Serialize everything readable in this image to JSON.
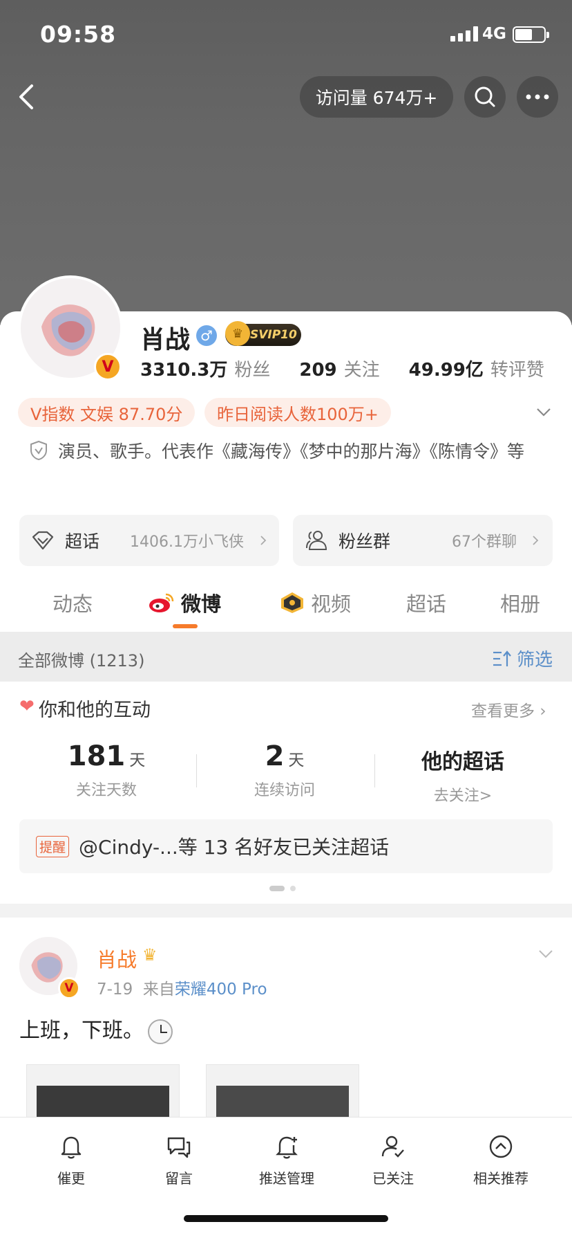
{
  "status": {
    "time": "09:58",
    "network": "4G"
  },
  "header": {
    "visits": "访问量 674万+"
  },
  "profile": {
    "name": "肖战",
    "svip": "SVIP10",
    "verify_mark": "♂",
    "v_badge": "V",
    "followers_num": "3310.3万",
    "followers_label": "粉丝",
    "following_num": "209",
    "following_label": "关注",
    "likes_num": "49.99亿",
    "likes_label": "转评赞",
    "tag1": "V指数 文娱 87.70分",
    "tag2": "昨日阅读人数100万+",
    "bio": "演员、歌手。代表作《藏海传》《梦中的那片海》《陈情令》等"
  },
  "pills": {
    "supertopic_label": "超话",
    "supertopic_value": "1406.1万小飞侠",
    "fangroup_label": "粉丝群",
    "fangroup_value": "67个群聊"
  },
  "tabs": [
    "动态",
    "微博",
    "视频",
    "超话",
    "相册"
  ],
  "filter": {
    "all": "全部微博 (1213)",
    "filter_label": "筛选"
  },
  "interaction": {
    "title": "你和他的互动",
    "see_more": "查看更多",
    "days_num": "181",
    "days_unit": "天",
    "days_label": "关注天数",
    "visits_num": "2",
    "visits_unit": "天",
    "visits_label": "连续访问",
    "topic_title": "他的超话",
    "topic_sub": "去关注>",
    "remind_tag": "提醒",
    "remind_text": "@Cindy-...等 13 名好友已关注超话"
  },
  "post": {
    "name": "肖战",
    "date": "7-19",
    "from": "来自",
    "device": "荣耀400 Pro",
    "text": "上班，下班。"
  },
  "bottom_nav": [
    "催更",
    "留言",
    "推送管理",
    "已关注",
    "相关推荐"
  ],
  "colors": {
    "accent": "#f67b2b",
    "link": "#5b8fc9",
    "tag_bg": "#fdeee8",
    "tag_text": "#e8643b"
  }
}
